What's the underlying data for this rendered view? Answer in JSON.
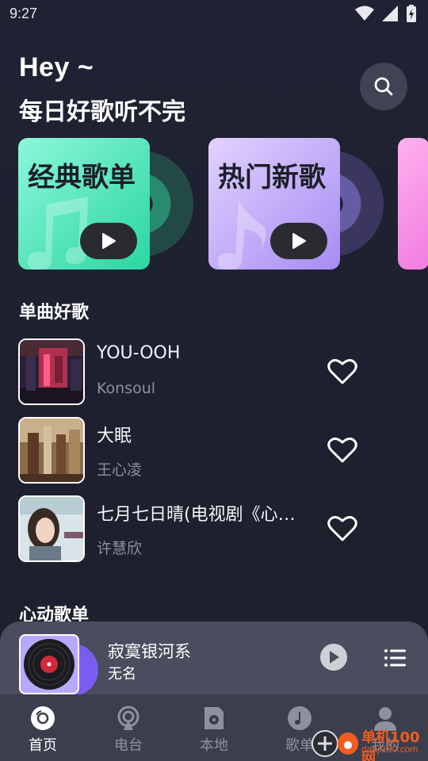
{
  "status_bar": {
    "time": "9:27"
  },
  "header": {
    "greeting": "Hey ~",
    "subtitle": "每日好歌听不完"
  },
  "cards": [
    {
      "title": "经典歌单",
      "color": "#2ad6a2"
    },
    {
      "title": "热门新歌",
      "color": "#a68cf2"
    },
    {
      "title": "",
      "color": "#f07ce0"
    }
  ],
  "sections": {
    "singles": "单曲好歌",
    "playlists": "心动歌单"
  },
  "songs": [
    {
      "title": "YOU-OOH",
      "artist": "Konsoul"
    },
    {
      "title": "大眠",
      "artist": "王心凌"
    },
    {
      "title": "七月七日晴(电视剧《心…",
      "artist": "许慧欣"
    }
  ],
  "mini_player": {
    "title": "寂寞银河系",
    "artist": "无名"
  },
  "tabs": [
    {
      "label": "首页",
      "icon": "home-disc-icon",
      "active": true
    },
    {
      "label": "电台",
      "icon": "radio-icon",
      "active": false
    },
    {
      "label": "本地",
      "icon": "local-file-icon",
      "active": false
    },
    {
      "label": "歌单",
      "icon": "playlist-note-icon",
      "active": false
    },
    {
      "label": "我的",
      "icon": "profile-icon",
      "active": false
    }
  ],
  "watermark": {
    "name": "单机100网",
    "url": "danji100.com"
  }
}
